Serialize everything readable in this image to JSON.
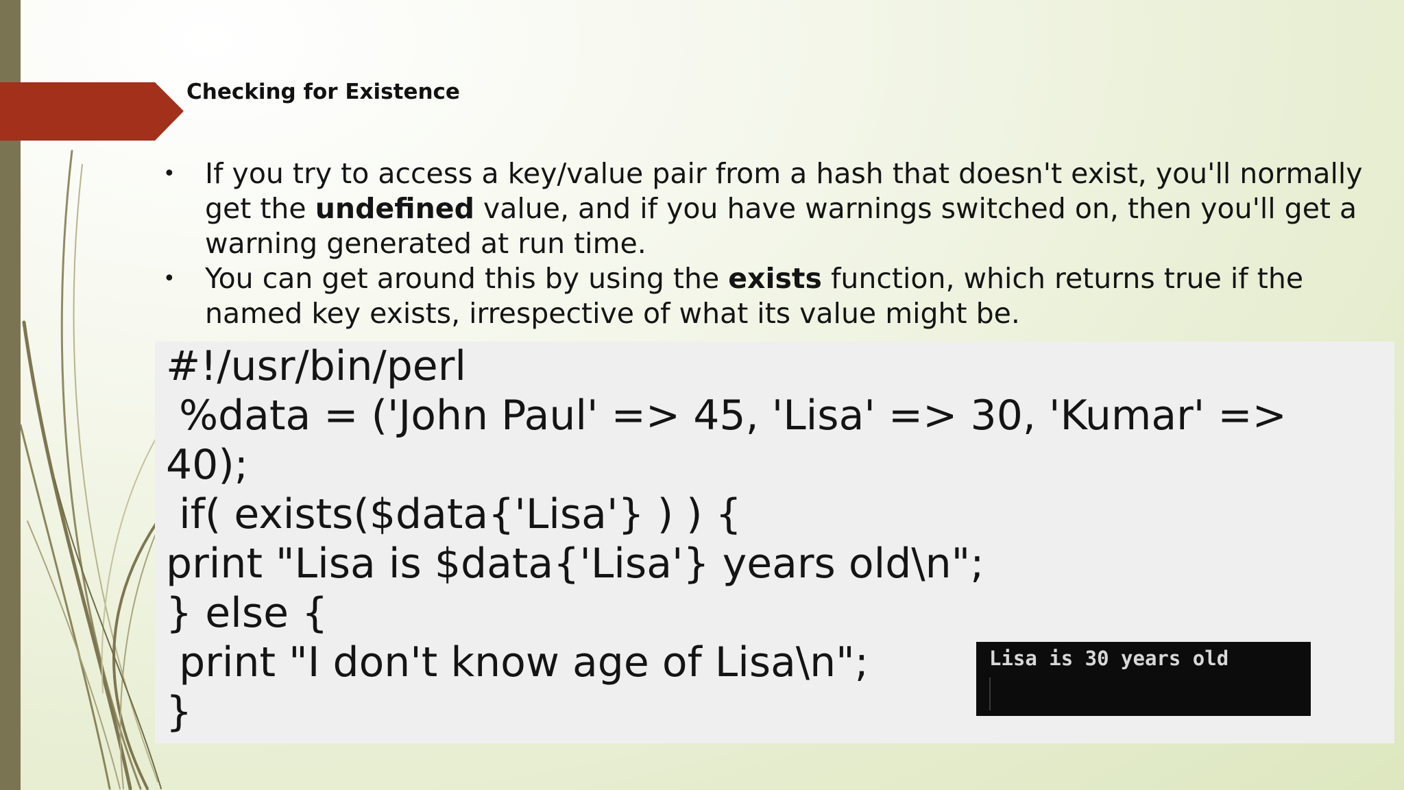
{
  "slide": {
    "title": "Checking for Existence",
    "accent_color": "#a3301a",
    "bar_color": "#7b7452"
  },
  "bullets": [
    {
      "before": "If you try to access a key/value pair from a hash that doesn't exist, you'll normally get the ",
      "bold": "undefined",
      "after": " value, and if you have warnings switched on, then you'll get a warning generated at run time."
    },
    {
      "before": "You can get around this by using the ",
      "bold": "exists",
      "after": " function, which returns true if the named key exists, irrespective of what its value might be."
    }
  ],
  "code": {
    "lines": [
      "#!/usr/bin/perl",
      " %data = ('John Paul' => 45, 'Lisa' => 30, 'Kumar' =>",
      "40);",
      " if( exists($data{'Lisa'} ) ) {",
      "print \"Lisa is $data{'Lisa'} years old\\n\";",
      "} else {",
      " print \"I don't know age of Lisa\\n\";",
      "}"
    ]
  },
  "terminal": {
    "output": "Lisa is 30 years old"
  }
}
